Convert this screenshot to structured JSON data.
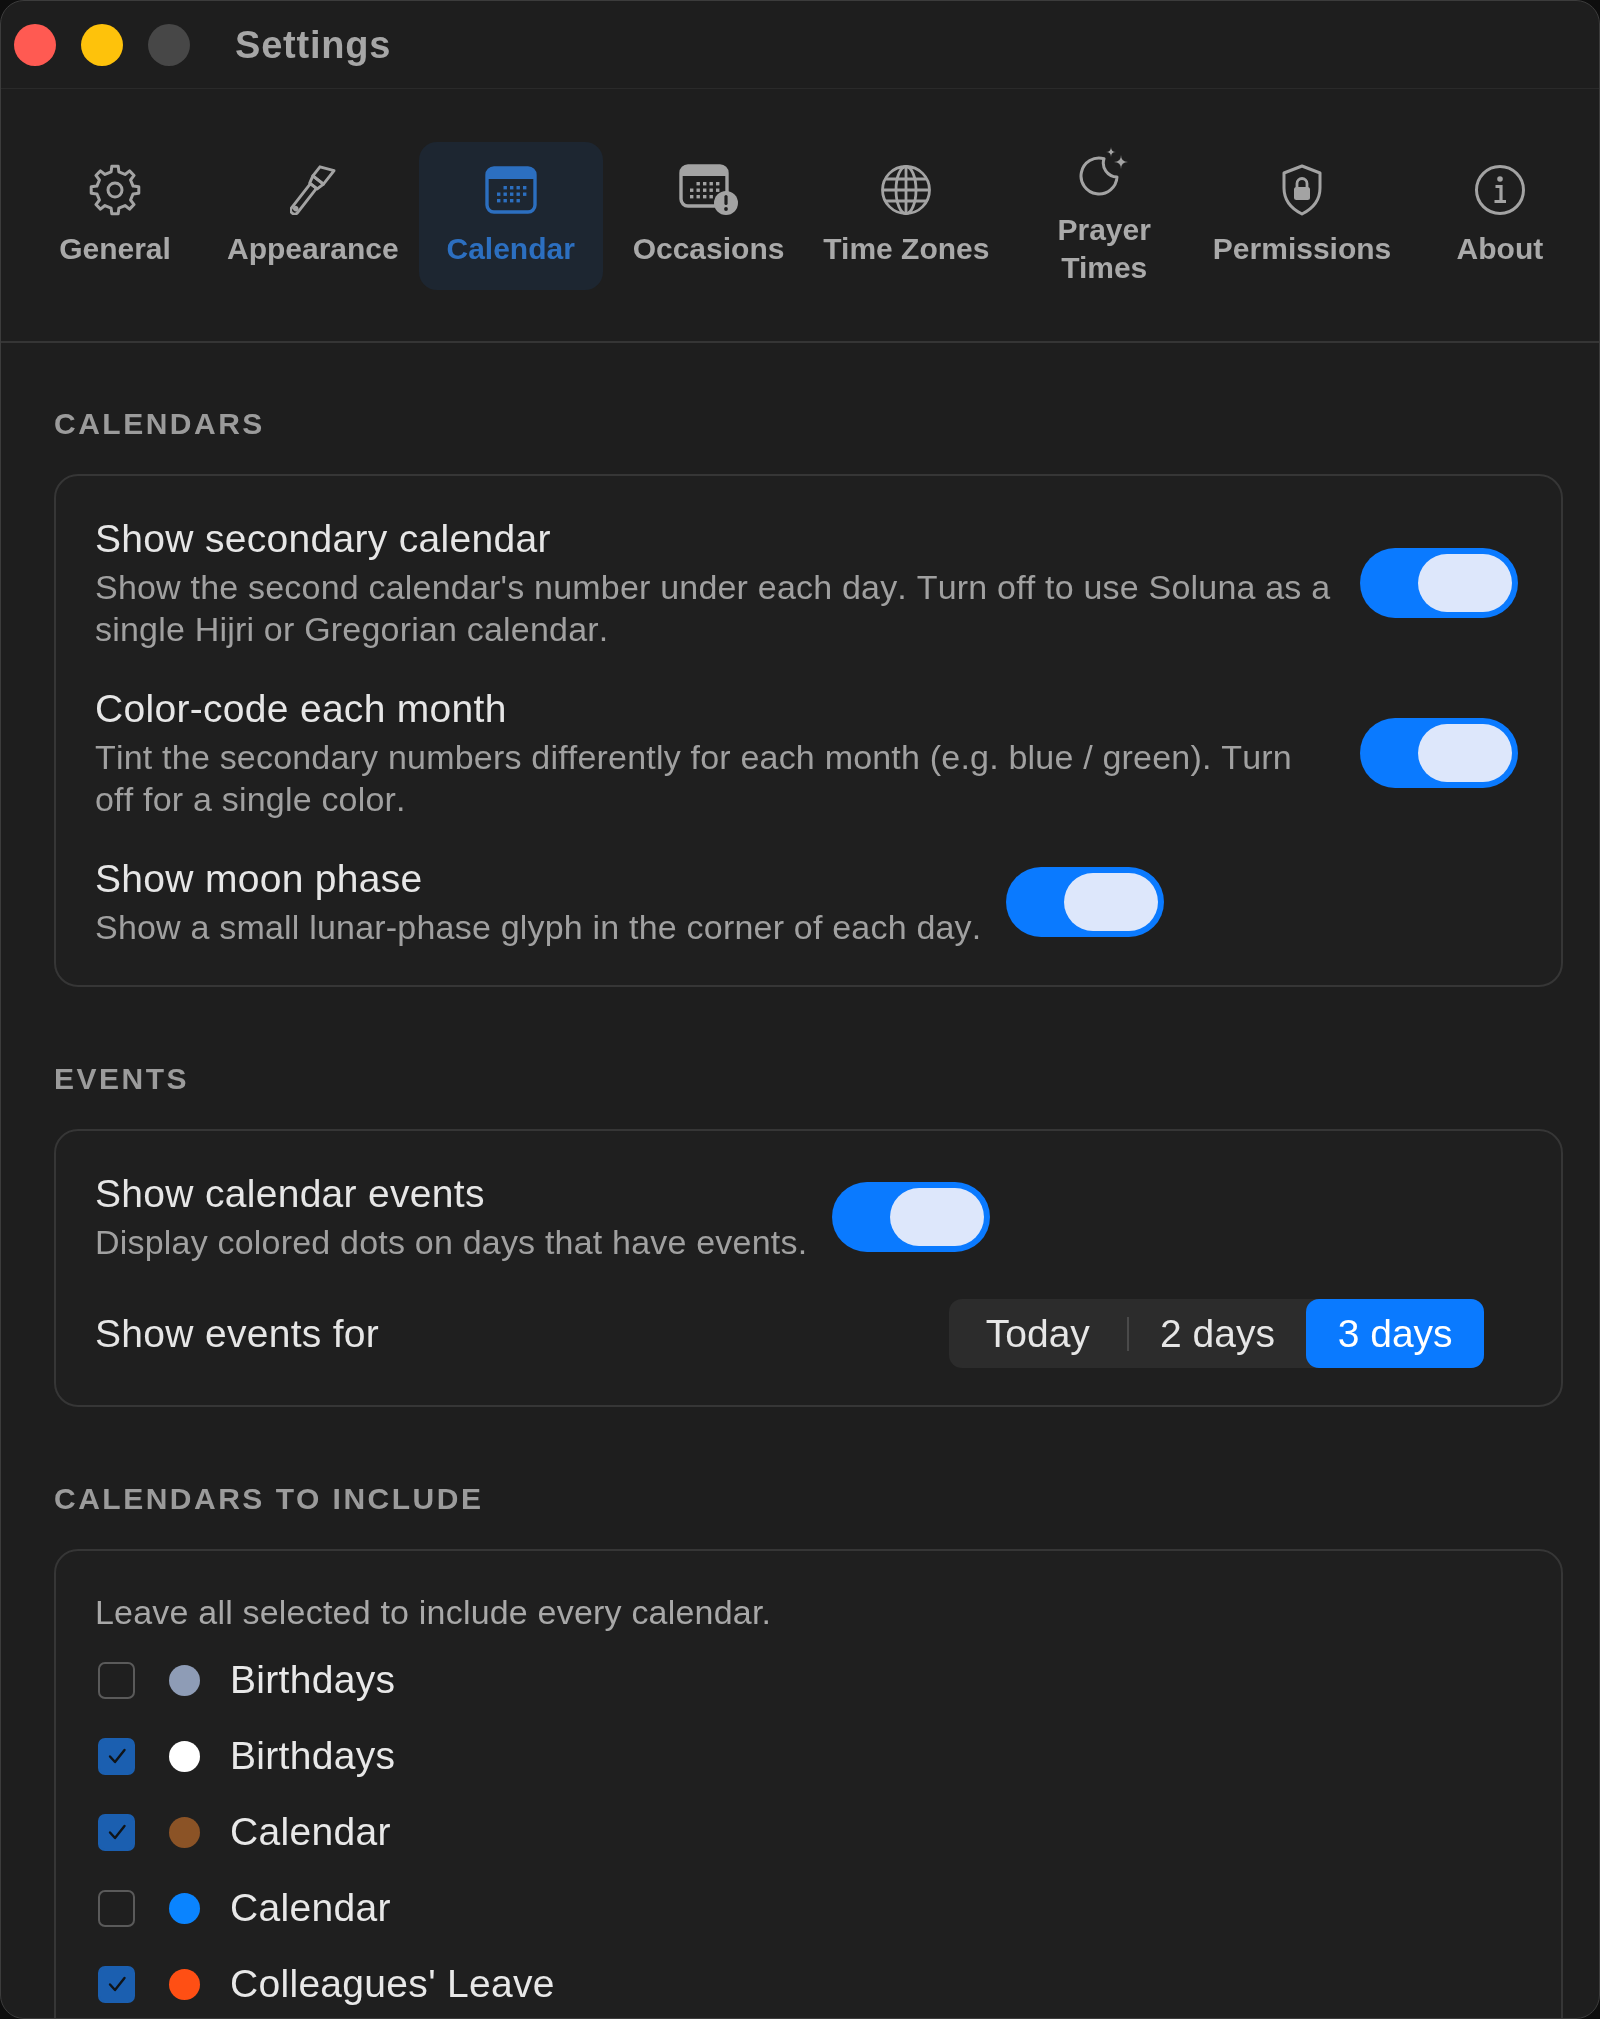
{
  "window": {
    "title": "Settings",
    "controls": [
      {
        "kind": "close",
        "disabled": false
      },
      {
        "kind": "minimize",
        "disabled": false
      },
      {
        "kind": "zoom",
        "disabled": true
      }
    ]
  },
  "tabs": [
    {
      "label": "General",
      "selected": false
    },
    {
      "label": "Appearance",
      "selected": false
    },
    {
      "label": "Calendar",
      "selected": true
    },
    {
      "label": "Occasions",
      "selected": false
    },
    {
      "label": "Time Zones",
      "selected": false
    },
    {
      "label": "Prayer Times",
      "selected": false
    },
    {
      "label": "Permissions",
      "selected": false
    },
    {
      "label": "About",
      "selected": false
    }
  ],
  "sections": [
    {
      "title": "CALENDARS",
      "rows": [
        {
          "kind": "toggle",
          "title": "Show secondary calendar",
          "description": "Show the second calendar's number under each day. Turn off to use Soluna as a single Hijri or Gregorian calendar.",
          "on": true
        },
        {
          "kind": "toggle",
          "title": "Color-code each month",
          "description": "Tint the secondary numbers differently for each month (e.g. blue / green). Turn off for a single color.",
          "on": true
        },
        {
          "kind": "toggle",
          "title": "Show moon phase",
          "description": "Show a small lunar-phase glyph in the corner of each day.",
          "on": true
        }
      ]
    },
    {
      "title": "EVENTS",
      "rows": [
        {
          "kind": "toggle",
          "title": "Show calendar events",
          "description": "Display colored dots on days that have events.",
          "on": true
        },
        {
          "kind": "segmented",
          "label": "Show events for",
          "options": [
            {
              "label": "Today",
              "selected": false
            },
            {
              "label": "2 days",
              "selected": false
            },
            {
              "label": "3 days",
              "selected": true
            }
          ]
        }
      ]
    },
    {
      "title": "CALENDARS TO INCLUDE",
      "rows": [
        {
          "kind": "note",
          "text": "Leave all selected to include every calendar."
        },
        {
          "kind": "checkbox",
          "label": "Birthdays",
          "checked": false,
          "color": "#8e9cb6"
        },
        {
          "kind": "checkbox",
          "label": "Birthdays",
          "checked": true,
          "color": "#ffffff"
        },
        {
          "kind": "checkbox",
          "label": "Calendar",
          "checked": true,
          "color": "#8b5326"
        },
        {
          "kind": "checkbox",
          "label": "Calendar",
          "checked": false,
          "color": "#0a84ff"
        },
        {
          "kind": "checkbox",
          "label": "Colleagues' Leave",
          "checked": true,
          "color": "#ff4f14"
        }
      ]
    }
  ]
}
